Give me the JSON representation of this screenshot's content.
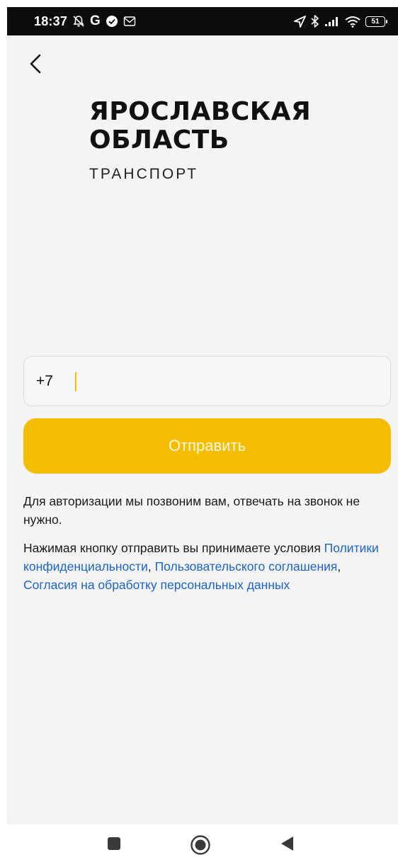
{
  "status_bar": {
    "time": "18:37",
    "left_icons": [
      "bell-off-icon",
      "google-icon",
      "check-circle-icon",
      "mail-icon"
    ],
    "google_letter": "G",
    "right_icons": [
      "location-arrow-icon",
      "bluetooth-icon",
      "signal-icon",
      "wifi-icon",
      "battery-icon"
    ],
    "battery": "51"
  },
  "header": {
    "back_icon": "chevron-left-icon"
  },
  "logo": {
    "title": "ЯРОСЛАВСКАЯ\nОБЛАСТЬ",
    "subtitle": "ТРАНСПОРТ"
  },
  "form": {
    "phone_value": "+7",
    "submit_label": "Отправить"
  },
  "info": {
    "call_notice": "Для авторизации мы позвоним вам, отвечать на звонок не нужно.",
    "terms_prefix": "Нажимая кнопку отправить вы принимаете условия ",
    "privacy_link": "Политики конфиденциальности",
    "sep1": ", ",
    "user_agreement_link": "Пользовательского соглашения",
    "sep2": ", ",
    "consent_link": "Согласия на обработку персональных данных"
  },
  "navbar": {
    "icons": [
      "recents-square-icon",
      "home-circle-icon",
      "back-triangle-icon"
    ]
  },
  "colors": {
    "accent": "#f5bd02",
    "link": "#1b64c8",
    "background": "#f4f4f5"
  }
}
